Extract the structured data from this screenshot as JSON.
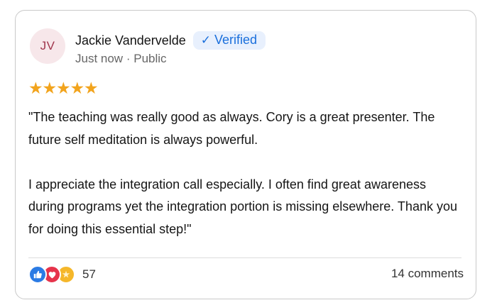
{
  "post": {
    "author": {
      "initials": "JV",
      "name": "Jackie Vandervelde",
      "verified_label": "Verified"
    },
    "timestamp": "Just now",
    "separator": "·",
    "visibility": "Public",
    "rating": 5,
    "rating_max": 5,
    "rating_glyph": "★",
    "body_paragraphs": [
      "\"The teaching was really good as always. Cory is a great presenter. The future self meditation is always powerful.",
      "I appreciate the integration call especially. I often find great awareness during programs yet the integration portion is missing elsewhere. Thank you for doing this essential step!\""
    ],
    "reactions": {
      "icons": [
        "like-icon",
        "love-icon",
        "care-icon"
      ],
      "count": "57"
    },
    "comments_label": "14 comments"
  },
  "colors": {
    "verified_accent": "#1a6fdc",
    "star": "#f2a41d",
    "avatar_bg": "#f7e7ea",
    "avatar_text": "#a0364d",
    "like": "#2b7be4",
    "love": "#e6334b",
    "care": "#f5b72a"
  }
}
